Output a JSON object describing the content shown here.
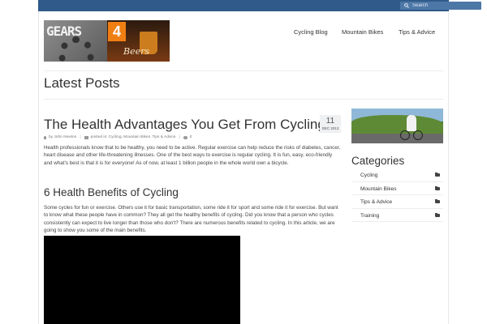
{
  "header": {
    "search": {
      "placeholder": "Search"
    },
    "logo": {
      "text_gears": "GEARS",
      "text_four": "4",
      "text_beers": "Beers"
    },
    "nav": [
      "Cycling Blog",
      "Mountain Bikes",
      "Tips & Advice"
    ]
  },
  "page": {
    "title": "Latest Posts"
  },
  "post": {
    "title": "The Health Advantages You Get From Cycling",
    "date_day": "11",
    "date_month": "DEC 2013",
    "meta": {
      "author": "by John Newton",
      "posted_in": "posted in: Cycling, Mountain Bikes, Tips & Advice",
      "comments": "0"
    },
    "intro": "Health professionals know that to be healthy, you need to be active. Regular exercise can help reduce the risks of diabetes, cancer, heart disease and other life-threatening illnesses. One of the best ways to exercise is regular cycling. It is fun, easy, eco-friendly and what's best is that it is for everyone! As of now, at least 1 billion people in the whole world own a bicycle.",
    "subheading": "6 Health Benefits of Cycling",
    "body": "Some cycles for fun or exercise. Others use it for basic transportation, some ride it for sport and some ride it for exercise. But want to know what these people have in common? They all get the healthy benefits of cycling. Did you know that a person who cycles consistently can expect to live longer than those who don't? There are numerous benefits related to cycling. In this article, we are going to show you some of the main benefits."
  },
  "sidebar": {
    "categories_title": "Categories",
    "categories": [
      "Cycling",
      "Mountain Bikes",
      "Tips & Advice",
      "Training"
    ]
  }
}
